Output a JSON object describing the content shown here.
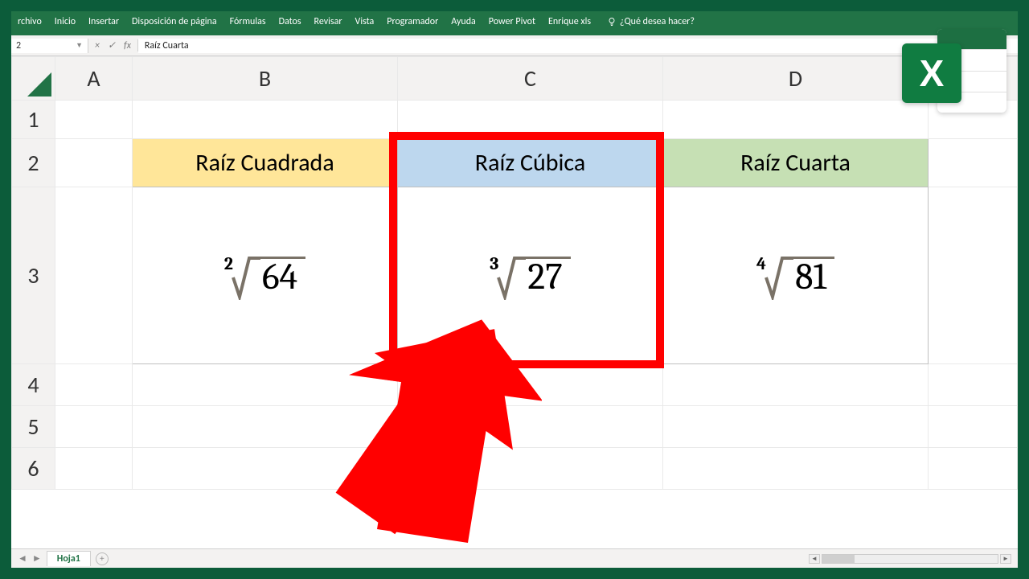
{
  "ribbon": {
    "tabs": [
      "rchivo",
      "Inicio",
      "Insertar",
      "Disposición de página",
      "Fórmulas",
      "Datos",
      "Revisar",
      "Vista",
      "Programador",
      "Ayuda",
      "Power Pivot",
      "Enrique xls"
    ],
    "tell_me": "¿Qué desea hacer?"
  },
  "formula_bar": {
    "name_box": "2",
    "cancel": "×",
    "enter": "✓",
    "fx": "fx",
    "value": "Raíz Cuarta"
  },
  "columns": [
    "A",
    "B",
    "C",
    "D"
  ],
  "rows": [
    "1",
    "2",
    "3",
    "4",
    "5",
    "6"
  ],
  "cells": {
    "b2": "Raíz Cuadrada",
    "c2": "Raíz Cúbica",
    "d2": "Raíz Cuarta",
    "b3": {
      "index": "2",
      "radicand": "64"
    },
    "c3": {
      "index": "3",
      "radicand": "27"
    },
    "d3": {
      "index": "4",
      "radicand": "81"
    }
  },
  "sheet_tabs": {
    "active": "Hoja1",
    "add": "+",
    "nav_l": "◄",
    "nav_r": "►"
  },
  "logo": "X"
}
